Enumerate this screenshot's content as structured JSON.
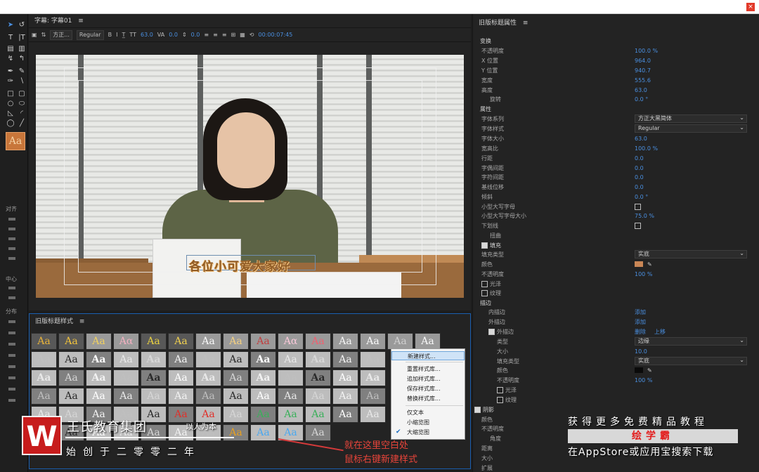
{
  "monitor": {
    "title": "字幕: 字幕01",
    "menu_icon": "≡",
    "toolbar": {
      "font": "方正...",
      "style": "Regular",
      "size": "63.0",
      "kerning": "0.0",
      "leading": "0.0",
      "timecode": "00:00:07:45"
    },
    "subtitle_text": "各位小可爱大家好"
  },
  "left_panel": {
    "align_label": "对齐",
    "center_label": "中心",
    "distribute_label": "分布",
    "style_glyph": "Aa"
  },
  "styles_panel": {
    "title": "旧版标题样式",
    "menu_icon": "≡",
    "swatch_glyphs": [
      "Aa",
      "Aa",
      "Aa",
      "Αα",
      "Aa",
      "Aa",
      "Aa",
      "Aa",
      "Aa",
      "Αα",
      "Aa",
      "Aa",
      "Aa",
      "Aa",
      "Aa"
    ]
  },
  "context_menu": {
    "items": [
      "新建样式...",
      "重置样式库...",
      "追加样式库...",
      "保存样式库...",
      "替换样式库...",
      "仅文本",
      "小缩览图",
      "大缩览图"
    ],
    "checked": "大缩览图"
  },
  "properties": {
    "title": "旧版标题属性",
    "menu_icon": "≡",
    "transform": {
      "section": "变换",
      "opacity_label": "不透明度",
      "opacity": "100.0 %",
      "x_label": "X 位置",
      "x": "964.0",
      "y_label": "Y 位置",
      "y": "940.7",
      "width_label": "宽度",
      "width": "555.6",
      "height_label": "高度",
      "height": "63.0",
      "rotation_label": "旋转",
      "rotation": "0.0 °"
    },
    "attributes": {
      "section": "属性",
      "font_family_label": "字体系列",
      "font_family": "方正大黑简体",
      "font_style_label": "字体样式",
      "font_style": "Regular",
      "font_size_label": "字体大小",
      "font_size": "63.0",
      "aspect_label": "宽高比",
      "aspect": "100.0 %",
      "leading_label": "行距",
      "leading": "0.0",
      "kerning_label": "字偶间距",
      "kerning": "0.0",
      "tracking_label": "字符间距",
      "tracking": "0.0",
      "baseline_label": "基线位移",
      "baseline": "0.0",
      "slant_label": "倾斜",
      "slant": "0.0 °",
      "smallcaps_label": "小型大写字母",
      "smallcaps_size_label": "小型大写字母大小",
      "smallcaps_size": "75.0 %",
      "underline_label": "下划线",
      "distort_label": "扭曲"
    },
    "fill": {
      "section": "填充",
      "type_label": "填充类型",
      "type": "实底",
      "color_label": "颜色",
      "color": "#c98656",
      "opacity_label": "不透明度",
      "opacity": "100 %",
      "sheen_label": "光泽",
      "texture_label": "纹理"
    },
    "stroke": {
      "section": "描边",
      "inner_label": "内描边",
      "inner_action": "添加",
      "outer_label": "外描边",
      "outer_action": "添加",
      "outer_item_label": "外描边",
      "delete_action": "删除",
      "up_action": "上移",
      "type_label": "类型",
      "type": "边缘",
      "size_label": "大小",
      "size": "10.0",
      "fill_type_label": "填充类型",
      "fill_type": "实底",
      "color_label": "颜色",
      "color": "#0a0a0a",
      "opacity_label": "不透明度",
      "opacity": "100 %",
      "sheen_label": "光泽",
      "texture_label": "纹理"
    },
    "shadow": {
      "section": "阴影",
      "color_label": "颜色",
      "opacity_label": "不透明度",
      "angle_label": "角度",
      "distance_label": "距离",
      "size_label": "大小",
      "spread_label": "扩展"
    }
  },
  "watermark": {
    "logo": "W",
    "brand": "王氏教育集团",
    "slogan": "以人为本",
    "founded": "始创于二零零二年"
  },
  "annotation": {
    "line1": "就在这里空白处",
    "line2": "鼠标右键新建样式"
  },
  "promo": {
    "line1": "获得更多免费精品教程",
    "line2": "绘学霸",
    "line3": "在AppStore或应用宝搜索下载"
  }
}
